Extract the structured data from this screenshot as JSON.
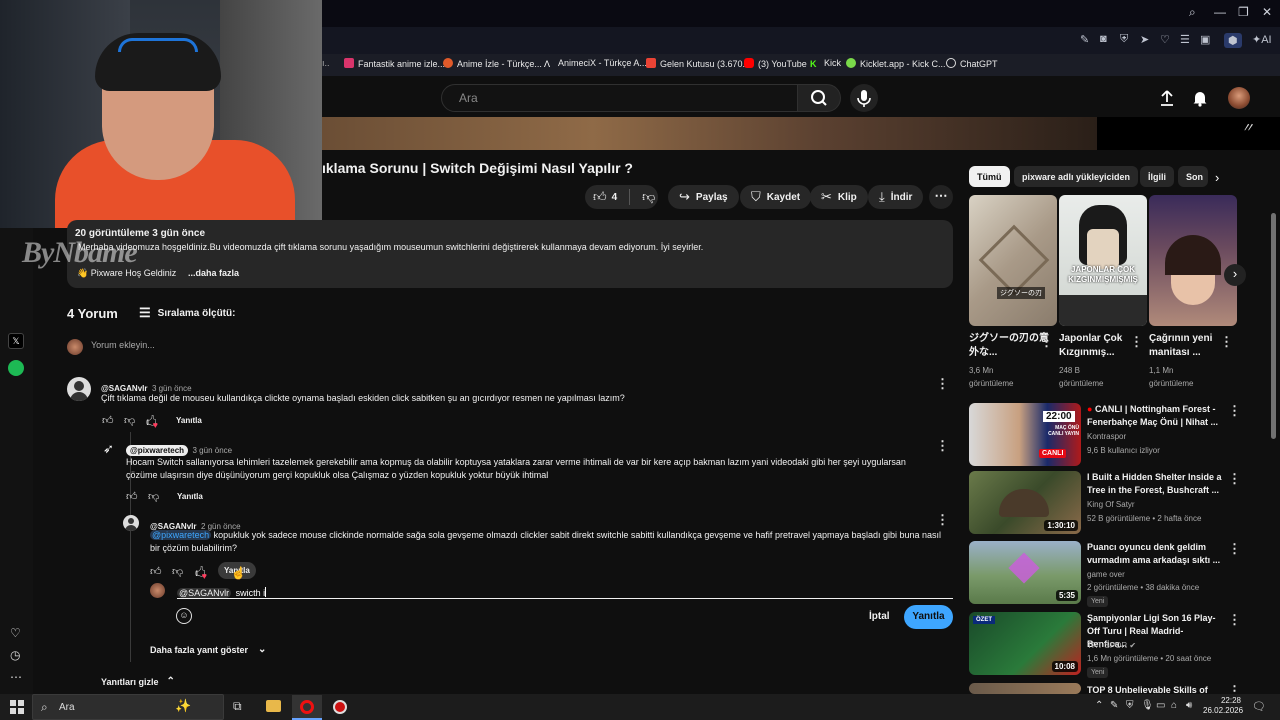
{
  "browser": {
    "bookmarks": [
      {
        "label": "Fantastik anime izle...",
        "color": "#d9346b"
      },
      {
        "label": "Anime İzle - Türkçe...",
        "color": "#e05a2a"
      },
      {
        "label": "AnimeciX - Türkçe A...",
        "color": "#ffffff"
      },
      {
        "label": "Gelen Kutusu (3.670...",
        "color": "#ea4335"
      },
      {
        "label": "(3) YouTube",
        "color": "#ff0000"
      },
      {
        "label": "Kick",
        "color": "#53fc18"
      },
      {
        "label": "Kicklet.app - Kick C...",
        "color": "#7ad94a"
      },
      {
        "label": "ChatGPT",
        "color": "#dddddd"
      }
    ],
    "ai_label": "AI"
  },
  "header": {
    "search_placeholder": "Ara"
  },
  "video": {
    "title": "ıklama Sorunu | Switch Değişimi Nasıl Yapılır ?",
    "likes": "4",
    "share": "Paylaş",
    "save": "Kaydet",
    "clip": "Klip",
    "download": "İndir",
    "views_date": "20 görüntüleme  3 gün önce",
    "description": "Merhaba videomuza hoşgeldiniz.Bu videomuzda çift tıklama sorunu yaşadığım mouseumun switchlerini değiştirerek kullanmaya devam ediyorum. İyi seyirler.",
    "desc_line2": "Pixware Hoş Geldiniz",
    "more": "...daha fazla"
  },
  "comments": {
    "count": "4 Yorum",
    "sort": "Sıralama ölçütü:",
    "add_placeholder": "Yorum ekleyin...",
    "items": [
      {
        "author": "@SAGANvlr",
        "date": "3 gün önce",
        "text": "Çift tıklama değil de mouseu kullandıkça clickte oynama başladı eskiden click sabitken şu an gıcırdıyor resmen ne yapılması lazım?",
        "reply": "Yanıtla"
      },
      {
        "author": "@pixwaretech",
        "date": "3 gün önce",
        "text": "Hocam Switch sallanıyorsa lehimleri tazelemek gerekebilir ama kopmuş da olabilir koptuysa yataklara zarar verme ihtimali de var bir kere açıp bakman lazım yani videodaki gibi her şeyi uygularsan çözüme ulaşırsın diye düşünüyorum gerçi kopukluk olsa Çalışmaz o yüzden kopukluk yoktur büyük ihtimal",
        "reply": "Yanıtla"
      },
      {
        "author": "@SAGANvlr",
        "date": "2 gün önce",
        "mention": "@pixwaretech",
        "text": " kopukluk yok sadece mouse clickinde normalde sağa sola gevşeme olmazdı clickler sabit direkt switchle sabitti kullandıkça gevşeme ve hafif pretravel yapmaya başladı gibi buna nasıl bir çözüm bulabilirim?",
        "reply": "Yanıtla"
      }
    ],
    "reply_box": {
      "mention": "@SAGANvlr",
      "text": "swicth i",
      "cancel": "İptal",
      "submit": "Yanıtla"
    },
    "more_replies": "Daha fazla yanıt göster",
    "hide_replies": "Yanıtları gizle"
  },
  "sidebar_right": {
    "chips": [
      "Tümü",
      "pixware adlı yükleyiciden",
      "İlgili",
      "Son"
    ],
    "shorts": [
      {
        "title": "ジグソーの刃の意外な...",
        "views": "3,6 Mn",
        "views2": "görüntüleme",
        "overlay": "ジグソーの刃"
      },
      {
        "title": "Japonlar Çok Kızgınmış...",
        "views": "248 B",
        "views2": "görüntüleme",
        "overlay": "JAPONLAR ÇOK KIZGINMIŞMIŞMIŞ"
      },
      {
        "title": "Çağrının yeni manitası ...",
        "views": "1,1 Mn",
        "views2": "görüntüleme",
        "overlay": ""
      }
    ],
    "videos": [
      {
        "title": "CANLI | Nottingham Forest - Fenerbahçe Maç Önü | Nihat ...",
        "channel": "Kontraspor",
        "meta": "9,6 B kullanıcı izliyor",
        "badge": "",
        "duration": "",
        "live": true,
        "time": "22:00",
        "overlay": "MAÇ ÖNÜ CANLI YAYIN",
        "live_badge": "CANLI"
      },
      {
        "title": "I Built a Hidden Shelter Inside a Tree in the Forest, Bushcraft ...",
        "channel": "King Of Satyr",
        "meta": "52 B görüntüleme • 2 hafta önce",
        "badge": "",
        "duration": "1:30:10",
        "live": false
      },
      {
        "title": "Puancı oyuncu denk geldim vurmadım ama arkadaşı sıktı ...",
        "channel": "game over",
        "meta": "2 görüntüleme • 38 dakika önce",
        "badge": "Yeni",
        "duration": "5:35",
        "live": false
      },
      {
        "title": "Şampiyonlar Ligi Son 16 Play-Off Turu | Real Madrid-Benfica...",
        "channel": "TRT SPOR",
        "meta": "1,6 Mn görüntüleme • 20 saat önce",
        "badge": "Yeni",
        "duration": "10:08",
        "live": false,
        "overlay": "ÖZET"
      },
      {
        "title": "TOP 8 Unbelievable Skills of",
        "channel": "",
        "meta": "",
        "badge": "",
        "duration": "",
        "live": false
      }
    ]
  },
  "watermark": "ByNbame",
  "taskbar": {
    "search": "Ara",
    "time": "22:28",
    "date": "26.02.2026"
  },
  "colors": {
    "accent_blue": "#3ea6ff",
    "red": "#ff0000",
    "bg": "#0f0f0f"
  }
}
